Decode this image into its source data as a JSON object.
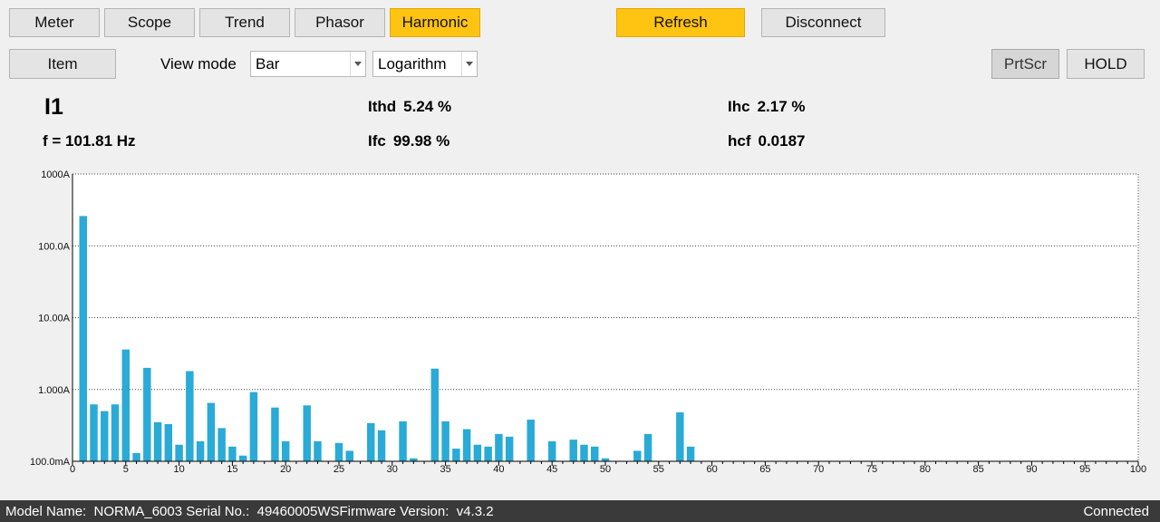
{
  "toolbar": {
    "tabs": [
      {
        "label": "Meter"
      },
      {
        "label": "Scope"
      },
      {
        "label": "Trend"
      },
      {
        "label": "Phasor"
      },
      {
        "label": "Harmonic"
      }
    ],
    "active_tab": "Harmonic",
    "refresh_label": "Refresh",
    "disconnect_label": "Disconnect"
  },
  "controls": {
    "item_label": "Item",
    "view_mode_label": "View mode",
    "view_mode_value": "Bar",
    "scale_value": "Logarithm",
    "prtscr_label": "PrtScr",
    "hold_label": "HOLD"
  },
  "readouts": {
    "channel": "I1",
    "frequency": "f = 101.81 Hz",
    "ithd_label": "Ithd",
    "ithd_value": "5.24 %",
    "ifc_label": "Ifc",
    "ifc_value": "99.98 %",
    "ihc_label": "Ihc",
    "ihc_value": "2.17 %",
    "hcf_label": "hcf",
    "hcf_value": "0.0187"
  },
  "colors": {
    "accent": "#ffc312",
    "bar": "#2aaad6",
    "footer_bg": "#3a3a3a"
  },
  "chart_data": {
    "type": "bar",
    "y_scale": "log",
    "ylim_A": [
      0.1,
      1000
    ],
    "y_ticks": [
      {
        "value": 1000,
        "label": "1000A"
      },
      {
        "value": 100,
        "label": "100.0A"
      },
      {
        "value": 10,
        "label": "10.00A"
      },
      {
        "value": 1,
        "label": "1.000A"
      },
      {
        "value": 0.1,
        "label": "100.0mA"
      }
    ],
    "xlim": [
      0,
      100
    ],
    "x_ticks": [
      0,
      5,
      10,
      15,
      20,
      25,
      30,
      35,
      40,
      45,
      50,
      55,
      60,
      65,
      70,
      75,
      80,
      85,
      90,
      95,
      100
    ],
    "grid": "horizontal-dotted",
    "harmonic_order": [
      1,
      2,
      3,
      4,
      5,
      6,
      7,
      8,
      9,
      10,
      11,
      12,
      13,
      14,
      15,
      16,
      17,
      18,
      19,
      20,
      21,
      22,
      23,
      24,
      25,
      26,
      27,
      28,
      29,
      30,
      31,
      32,
      33,
      34,
      35,
      36,
      37,
      38,
      39,
      40,
      41,
      42,
      43,
      44,
      45,
      46,
      47,
      48,
      49,
      50,
      51,
      52,
      53,
      54,
      55,
      56,
      57,
      58
    ],
    "values_A": [
      260,
      0.62,
      0.5,
      0.62,
      3.6,
      0.13,
      2.0,
      0.35,
      0.33,
      0.17,
      1.8,
      0.19,
      0.65,
      0.29,
      0.16,
      0.12,
      0.92,
      0.1,
      0.56,
      0.19,
      0.1,
      0.6,
      0.19,
      0.1,
      0.18,
      0.14,
      0.1,
      0.34,
      0.27,
      0.1,
      0.36,
      0.11,
      0.1,
      1.95,
      0.36,
      0.15,
      0.28,
      0.17,
      0.16,
      0.24,
      0.22,
      0.1,
      0.38,
      0.1,
      0.19,
      0.1,
      0.2,
      0.17,
      0.16,
      0.11,
      0.1,
      0.1,
      0.14,
      0.24,
      0.1,
      0.1,
      0.48,
      0.16
    ]
  },
  "footer": {
    "info": "Model Name:  NORMA_6003 Serial No.:  49460005WSFirmware Version:  v4.3.2",
    "status": "Connected"
  }
}
